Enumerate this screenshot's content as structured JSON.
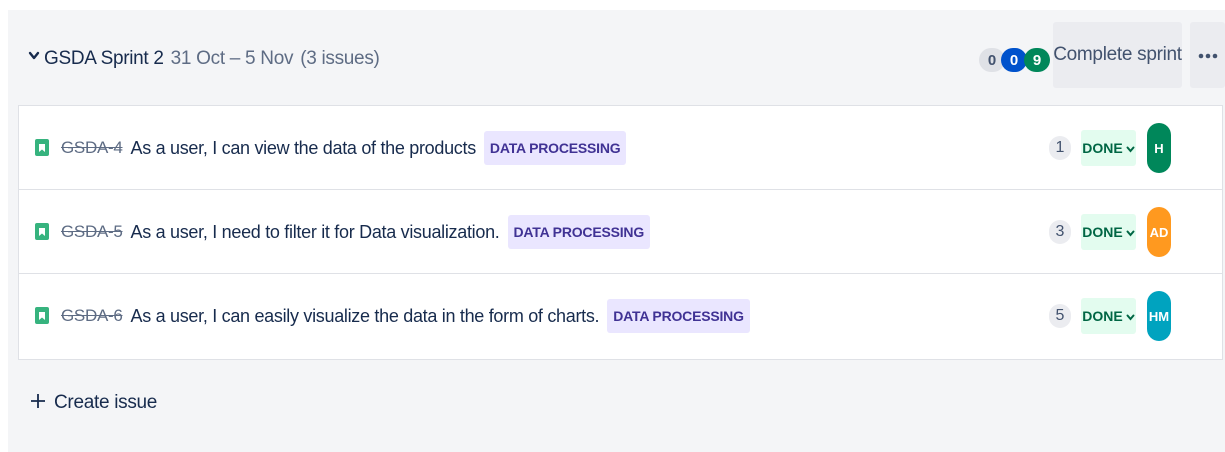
{
  "sprint": {
    "name": "GSDA Sprint 2",
    "dates": "31 Oct – 5 Nov",
    "issue_count": "(3 issues)",
    "counts": {
      "todo": "0",
      "in_progress": "0",
      "done": "9"
    },
    "complete_label": "Complete sprint",
    "more_icon": "more-horizontal-icon"
  },
  "issues": [
    {
      "key": "GSDA-4",
      "summary": "As a user, I can view the data of the products",
      "epic": "DATA PROCESSING",
      "points": "1",
      "status": "DONE",
      "assignee": {
        "initials": "H",
        "color": "#00875a"
      }
    },
    {
      "key": "GSDA-5",
      "summary": "As a user, I need to filter it for Data visualization.",
      "epic": "DATA PROCESSING",
      "points": "3",
      "status": "DONE",
      "assignee": {
        "initials": "AD",
        "color": "#ff991f"
      }
    },
    {
      "key": "GSDA-6",
      "summary": "As a user, I can easily visualize the data in the form of charts.",
      "epic": "DATA PROCESSING",
      "points": "5",
      "status": "DONE",
      "assignee": {
        "initials": "HM",
        "color": "#00a3bf"
      }
    }
  ],
  "create_issue": {
    "label": "Create issue",
    "icon": "plus-icon"
  },
  "icons": {
    "story": "story-icon",
    "expand": "chevron-down-icon",
    "status_dropdown": "chevron-down-icon"
  },
  "colors": {
    "story": "#36b37e",
    "epic_bg": "#eae6ff",
    "epic_text": "#403294",
    "done_bg": "#e3fcef",
    "done_text": "#006644",
    "inprogress_pill": "#0052cc",
    "done_pill": "#00875a"
  }
}
